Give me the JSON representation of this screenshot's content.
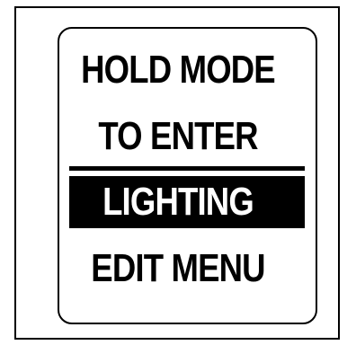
{
  "screen": {
    "lines": {
      "line1": "HOLD MODE",
      "line2": "TO ENTER",
      "line3": "LIGHTING",
      "line4": "EDIT MENU"
    },
    "highlighted_line": "line3"
  },
  "colors": {
    "foreground": "#000000",
    "background": "#ffffff",
    "highlight_text": "#ffffff"
  }
}
